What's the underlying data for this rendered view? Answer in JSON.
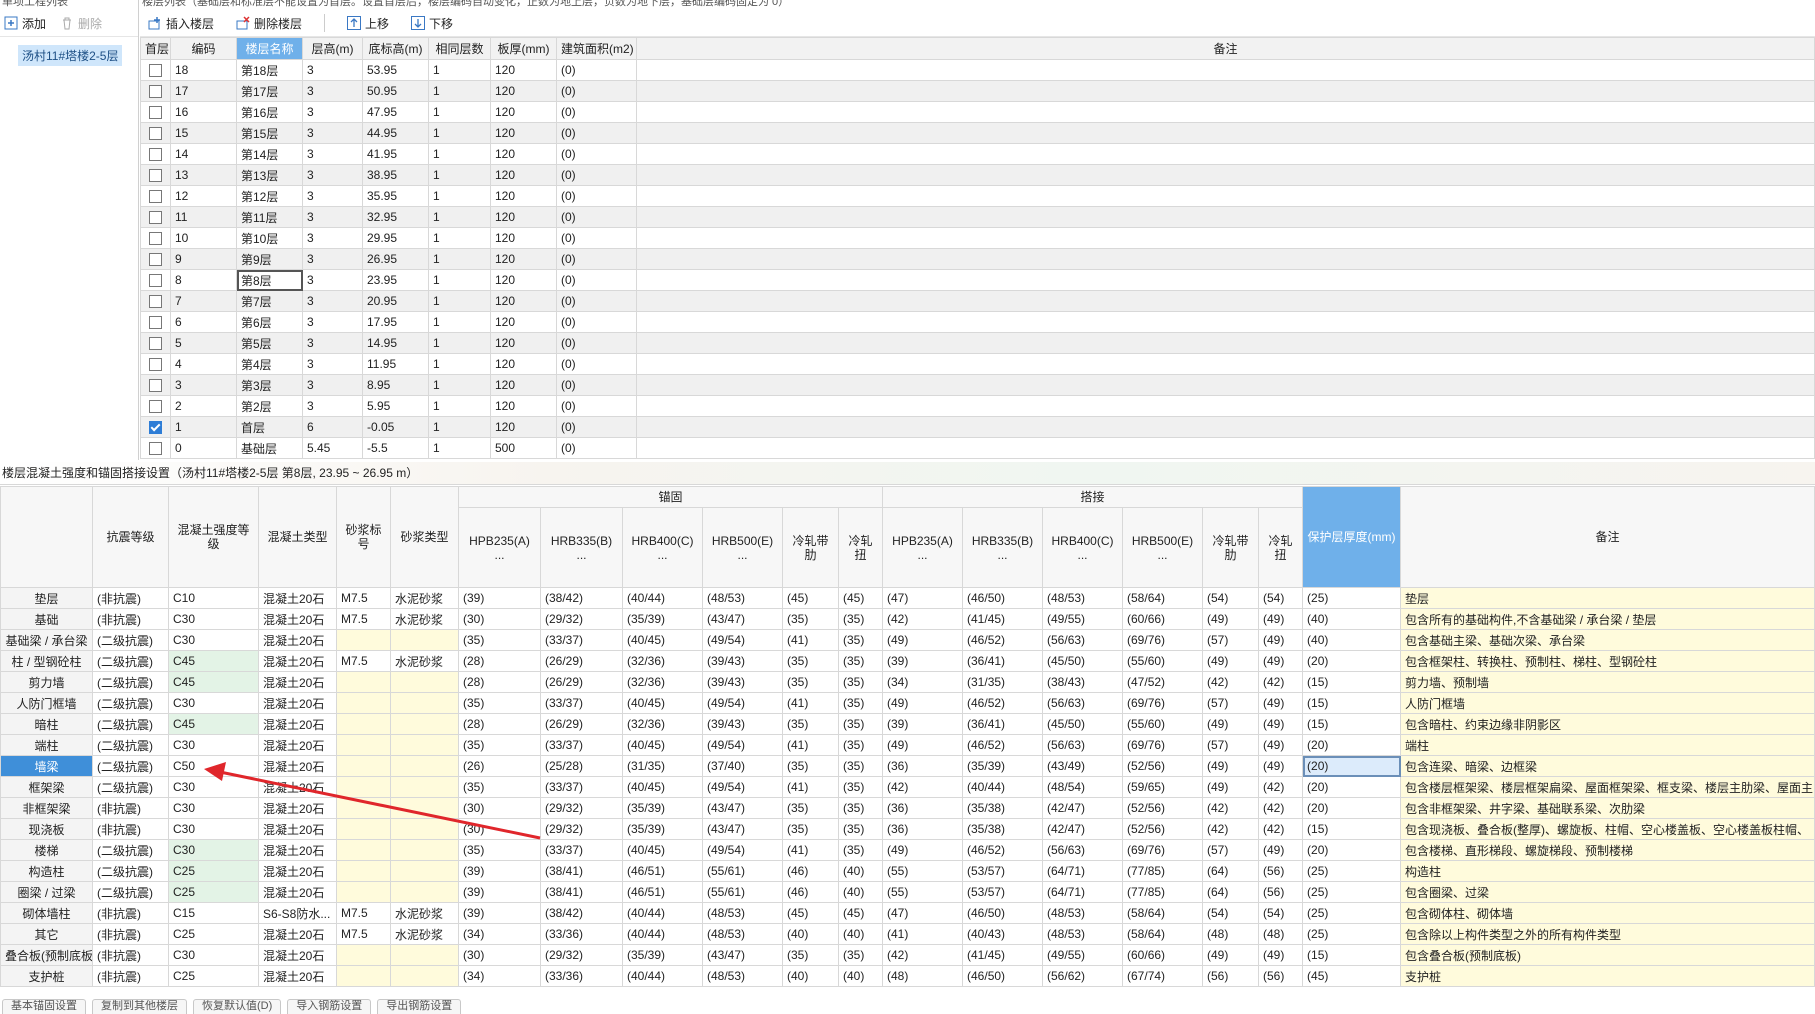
{
  "left": {
    "title": "单项工程列表",
    "add_label": "添加",
    "delete_label": "删除",
    "project_item": "汤村11#塔楼2-5层"
  },
  "floors": {
    "title": "楼层列表（基础层和标准层不能设置为首层。设置首层后，楼层编码自动变化，正数为地上层，负数为地下层，基础层编码固定为 0）",
    "toolbar": {
      "insert": "插入楼层",
      "delete": "删除楼层",
      "up": "上移",
      "down": "下移"
    },
    "columns": [
      "首层",
      "编码",
      "楼层名称",
      "层高(m)",
      "底标高(m)",
      "相同层数",
      "板厚(mm)",
      "建筑面积(m2)",
      "备注"
    ],
    "rows": [
      {
        "first": false,
        "code": "18",
        "name": "第18层",
        "height": "3",
        "bottom": "53.95",
        "same": "1",
        "thick": "120",
        "area": "(0)",
        "note": ""
      },
      {
        "first": false,
        "code": "17",
        "name": "第17层",
        "height": "3",
        "bottom": "50.95",
        "same": "1",
        "thick": "120",
        "area": "(0)",
        "note": ""
      },
      {
        "first": false,
        "code": "16",
        "name": "第16层",
        "height": "3",
        "bottom": "47.95",
        "same": "1",
        "thick": "120",
        "area": "(0)",
        "note": ""
      },
      {
        "first": false,
        "code": "15",
        "name": "第15层",
        "height": "3",
        "bottom": "44.95",
        "same": "1",
        "thick": "120",
        "area": "(0)",
        "note": ""
      },
      {
        "first": false,
        "code": "14",
        "name": "第14层",
        "height": "3",
        "bottom": "41.95",
        "same": "1",
        "thick": "120",
        "area": "(0)",
        "note": ""
      },
      {
        "first": false,
        "code": "13",
        "name": "第13层",
        "height": "3",
        "bottom": "38.95",
        "same": "1",
        "thick": "120",
        "area": "(0)",
        "note": ""
      },
      {
        "first": false,
        "code": "12",
        "name": "第12层",
        "height": "3",
        "bottom": "35.95",
        "same": "1",
        "thick": "120",
        "area": "(0)",
        "note": ""
      },
      {
        "first": false,
        "code": "11",
        "name": "第11层",
        "height": "3",
        "bottom": "32.95",
        "same": "1",
        "thick": "120",
        "area": "(0)",
        "note": ""
      },
      {
        "first": false,
        "code": "10",
        "name": "第10层",
        "height": "3",
        "bottom": "29.95",
        "same": "1",
        "thick": "120",
        "area": "(0)",
        "note": ""
      },
      {
        "first": false,
        "code": "9",
        "name": "第9层",
        "height": "3",
        "bottom": "26.95",
        "same": "1",
        "thick": "120",
        "area": "(0)",
        "note": ""
      },
      {
        "first": false,
        "code": "8",
        "name": "第8层",
        "height": "3",
        "bottom": "23.95",
        "same": "1",
        "thick": "120",
        "area": "(0)",
        "note": ""
      },
      {
        "first": false,
        "code": "7",
        "name": "第7层",
        "height": "3",
        "bottom": "20.95",
        "same": "1",
        "thick": "120",
        "area": "(0)",
        "note": ""
      },
      {
        "first": false,
        "code": "6",
        "name": "第6层",
        "height": "3",
        "bottom": "17.95",
        "same": "1",
        "thick": "120",
        "area": "(0)",
        "note": ""
      },
      {
        "first": false,
        "code": "5",
        "name": "第5层",
        "height": "3",
        "bottom": "14.95",
        "same": "1",
        "thick": "120",
        "area": "(0)",
        "note": ""
      },
      {
        "first": false,
        "code": "4",
        "name": "第4层",
        "height": "3",
        "bottom": "11.95",
        "same": "1",
        "thick": "120",
        "area": "(0)",
        "note": ""
      },
      {
        "first": false,
        "code": "3",
        "name": "第3层",
        "height": "3",
        "bottom": "8.95",
        "same": "1",
        "thick": "120",
        "area": "(0)",
        "note": ""
      },
      {
        "first": false,
        "code": "2",
        "name": "第2层",
        "height": "3",
        "bottom": "5.95",
        "same": "1",
        "thick": "120",
        "area": "(0)",
        "note": ""
      },
      {
        "first": true,
        "code": "1",
        "name": "首层",
        "height": "6",
        "bottom": "-0.05",
        "same": "1",
        "thick": "120",
        "area": "(0)",
        "note": ""
      },
      {
        "first": false,
        "code": "0",
        "name": "基础层",
        "height": "5.45",
        "bottom": "-5.5",
        "same": "1",
        "thick": "500",
        "area": "(0)",
        "note": ""
      }
    ]
  },
  "anchor": {
    "title": "楼层混凝土强度和锚固搭接设置（汤村11#塔楼2-5层  第8层, 23.95 ~ 26.95 m）",
    "group_anchor": "锚固",
    "group_lap": "搭接",
    "headers": {
      "seismic": "抗震等级",
      "grade": "混凝土强度等级",
      "ctype": "混凝土类型",
      "mortar_no": "砂浆标号",
      "mortar_type": "砂浆类型",
      "hpb235": "HPB235(A) ...",
      "hrb335": "HRB335(B) ...",
      "hrb400": "HRB400(C) ...",
      "hrb500": "HRB500(E) ...",
      "crb": "冷轧带肋",
      "crt": "冷轧扭",
      "cover": "保护层厚度(mm)",
      "note": "备注"
    },
    "rows": [
      {
        "name": "垫层",
        "seis": "(非抗震)",
        "grade": "C10",
        "ctype": "混凝土20石",
        "mno": "M7.5",
        "mtype": "水泥砂浆",
        "a": [
          "(39)",
          "(38/42)",
          "(40/44)",
          "(48/53)",
          "(45)",
          "(45)"
        ],
        "l": [
          "(47)",
          "(46/50)",
          "(48/53)",
          "(58/64)",
          "(54)",
          "(54)"
        ],
        "cover": "(25)",
        "note": "垫层"
      },
      {
        "name": "基础",
        "seis": "(非抗震)",
        "grade": "C30",
        "ctype": "混凝土20石",
        "mno": "M7.5",
        "mtype": "水泥砂浆",
        "a": [
          "(30)",
          "(29/32)",
          "(35/39)",
          "(43/47)",
          "(35)",
          "(35)"
        ],
        "l": [
          "(42)",
          "(41/45)",
          "(49/55)",
          "(60/66)",
          "(49)",
          "(49)"
        ],
        "cover": "(40)",
        "note": "包含所有的基础构件,不含基础梁 / 承台梁 / 垫层"
      },
      {
        "name": "基础梁 / 承台梁",
        "seis": "(二级抗震)",
        "grade": "C30",
        "ctype": "混凝土20石",
        "mno": "",
        "mtype": "",
        "a": [
          "(35)",
          "(33/37)",
          "(40/45)",
          "(49/54)",
          "(41)",
          "(35)"
        ],
        "l": [
          "(49)",
          "(46/52)",
          "(56/63)",
          "(69/76)",
          "(57)",
          "(49)"
        ],
        "cover": "(40)",
        "note": "包含基础主梁、基础次梁、承台梁"
      },
      {
        "name": "柱 / 型钢砼柱",
        "seis": "(二级抗震)",
        "grade": "C45",
        "ctype": "混凝土20石",
        "mno": "M7.5",
        "mtype": "水泥砂浆",
        "a": [
          "(28)",
          "(26/29)",
          "(32/36)",
          "(39/43)",
          "(35)",
          "(35)"
        ],
        "l": [
          "(39)",
          "(36/41)",
          "(45/50)",
          "(55/60)",
          "(49)",
          "(49)"
        ],
        "cover": "(20)",
        "note": "包含框架柱、转换柱、预制柱、梯柱、型钢砼柱"
      },
      {
        "name": "剪力墙",
        "seis": "(二级抗震)",
        "grade": "C45",
        "ctype": "混凝土20石",
        "mno": "",
        "mtype": "",
        "a": [
          "(28)",
          "(26/29)",
          "(32/36)",
          "(39/43)",
          "(35)",
          "(35)"
        ],
        "l": [
          "(34)",
          "(31/35)",
          "(38/43)",
          "(47/52)",
          "(42)",
          "(42)"
        ],
        "cover": "(15)",
        "note": "剪力墙、预制墙"
      },
      {
        "name": "人防门框墙",
        "seis": "(二级抗震)",
        "grade": "C30",
        "ctype": "混凝土20石",
        "mno": "",
        "mtype": "",
        "a": [
          "(35)",
          "(33/37)",
          "(40/45)",
          "(49/54)",
          "(41)",
          "(35)"
        ],
        "l": [
          "(49)",
          "(46/52)",
          "(56/63)",
          "(69/76)",
          "(57)",
          "(49)"
        ],
        "cover": "(15)",
        "note": "人防门框墙"
      },
      {
        "name": "暗柱",
        "seis": "(二级抗震)",
        "grade": "C45",
        "ctype": "混凝土20石",
        "mno": "",
        "mtype": "",
        "a": [
          "(28)",
          "(26/29)",
          "(32/36)",
          "(39/43)",
          "(35)",
          "(35)"
        ],
        "l": [
          "(39)",
          "(36/41)",
          "(45/50)",
          "(55/60)",
          "(49)",
          "(49)"
        ],
        "cover": "(15)",
        "note": "包含暗柱、约束边缘非阴影区"
      },
      {
        "name": "端柱",
        "seis": "(二级抗震)",
        "grade": "C30",
        "ctype": "混凝土20石",
        "mno": "",
        "mtype": "",
        "a": [
          "(35)",
          "(33/37)",
          "(40/45)",
          "(49/54)",
          "(41)",
          "(35)"
        ],
        "l": [
          "(49)",
          "(46/52)",
          "(56/63)",
          "(69/76)",
          "(57)",
          "(49)"
        ],
        "cover": "(20)",
        "note": "端柱"
      },
      {
        "name": "墙梁",
        "seis": "(二级抗震)",
        "grade": "C50",
        "ctype": "混凝土20石",
        "mno": "",
        "mtype": "",
        "a": [
          "(26)",
          "(25/28)",
          "(31/35)",
          "(37/40)",
          "(35)",
          "(35)"
        ],
        "l": [
          "(36)",
          "(35/39)",
          "(43/49)",
          "(52/56)",
          "(49)",
          "(49)"
        ],
        "cover": "(20)",
        "note": "包含连梁、暗梁、边框梁",
        "selected": true
      },
      {
        "name": "框架梁",
        "seis": "(二级抗震)",
        "grade": "C30",
        "ctype": "混凝土20石",
        "mno": "",
        "mtype": "",
        "a": [
          "(35)",
          "(33/37)",
          "(40/45)",
          "(49/54)",
          "(41)",
          "(35)"
        ],
        "l": [
          "(42)",
          "(40/44)",
          "(48/54)",
          "(59/65)",
          "(49)",
          "(42)"
        ],
        "cover": "(20)",
        "note": "包含楼层框架梁、楼层框架扁梁、屋面框架梁、框支梁、楼层主肋梁、屋面主"
      },
      {
        "name": "非框架梁",
        "seis": "(非抗震)",
        "grade": "C30",
        "ctype": "混凝土20石",
        "mno": "",
        "mtype": "",
        "a": [
          "(30)",
          "(29/32)",
          "(35/39)",
          "(43/47)",
          "(35)",
          "(35)"
        ],
        "l": [
          "(36)",
          "(35/38)",
          "(42/47)",
          "(52/56)",
          "(42)",
          "(42)"
        ],
        "cover": "(20)",
        "note": "包含非框架梁、井字梁、基础联系梁、次肋梁"
      },
      {
        "name": "现浇板",
        "seis": "(非抗震)",
        "grade": "C30",
        "ctype": "混凝土20石",
        "mno": "",
        "mtype": "",
        "a": [
          "(30)",
          "(29/32)",
          "(35/39)",
          "(43/47)",
          "(35)",
          "(35)"
        ],
        "l": [
          "(36)",
          "(35/38)",
          "(42/47)",
          "(52/56)",
          "(42)",
          "(42)"
        ],
        "cover": "(15)",
        "note": "包含现浇板、叠合板(整厚)、螺旋板、柱帽、空心楼盖板、空心楼盖板柱帽、"
      },
      {
        "name": "楼梯",
        "seis": "(二级抗震)",
        "grade": "C30",
        "ctype": "混凝土20石",
        "mno": "",
        "mtype": "",
        "a": [
          "(35)",
          "(33/37)",
          "(40/45)",
          "(49/54)",
          "(41)",
          "(35)"
        ],
        "l": [
          "(49)",
          "(46/52)",
          "(56/63)",
          "(69/76)",
          "(57)",
          "(49)"
        ],
        "cover": "(20)",
        "note": "包含楼梯、直形梯段、螺旋梯段、预制楼梯"
      },
      {
        "name": "构造柱",
        "seis": "(二级抗震)",
        "grade": "C25",
        "ctype": "混凝土20石",
        "mno": "",
        "mtype": "",
        "a": [
          "(39)",
          "(38/41)",
          "(46/51)",
          "(55/61)",
          "(46)",
          "(40)"
        ],
        "l": [
          "(55)",
          "(53/57)",
          "(64/71)",
          "(77/85)",
          "(64)",
          "(56)"
        ],
        "cover": "(25)",
        "note": "构造柱"
      },
      {
        "name": "圈梁 / 过梁",
        "seis": "(二级抗震)",
        "grade": "C25",
        "ctype": "混凝土20石",
        "mno": "",
        "mtype": "",
        "a": [
          "(39)",
          "(38/41)",
          "(46/51)",
          "(55/61)",
          "(46)",
          "(40)"
        ],
        "l": [
          "(55)",
          "(53/57)",
          "(64/71)",
          "(77/85)",
          "(64)",
          "(56)"
        ],
        "cover": "(25)",
        "note": "包含圈梁、过梁"
      },
      {
        "name": "砌体墙柱",
        "seis": "(非抗震)",
        "grade": "C15",
        "ctype": "S6-S8防水...",
        "mno": "M7.5",
        "mtype": "水泥砂浆",
        "a": [
          "(39)",
          "(38/42)",
          "(40/44)",
          "(48/53)",
          "(45)",
          "(45)"
        ],
        "l": [
          "(47)",
          "(46/50)",
          "(48/53)",
          "(58/64)",
          "(54)",
          "(54)"
        ],
        "cover": "(25)",
        "note": "包含砌体柱、砌体墙"
      },
      {
        "name": "其它",
        "seis": "(非抗震)",
        "grade": "C25",
        "ctype": "混凝土20石",
        "mno": "M7.5",
        "mtype": "水泥砂浆",
        "a": [
          "(34)",
          "(33/36)",
          "(40/44)",
          "(48/53)",
          "(40)",
          "(40)"
        ],
        "l": [
          "(41)",
          "(40/43)",
          "(48/53)",
          "(58/64)",
          "(48)",
          "(48)"
        ],
        "cover": "(25)",
        "note": "包含除以上构件类型之外的所有构件类型"
      },
      {
        "name": "叠合板(预制底板)",
        "seis": "(非抗震)",
        "grade": "C30",
        "ctype": "混凝土20石",
        "mno": "",
        "mtype": "",
        "a": [
          "(30)",
          "(29/32)",
          "(35/39)",
          "(43/47)",
          "(35)",
          "(35)"
        ],
        "l": [
          "(42)",
          "(41/45)",
          "(49/55)",
          "(60/66)",
          "(49)",
          "(49)"
        ],
        "cover": "(15)",
        "note": "包含叠合板(预制底板)"
      },
      {
        "name": "支护桩",
        "seis": "(非抗震)",
        "grade": "C25",
        "ctype": "混凝土20石",
        "mno": "",
        "mtype": "",
        "a": [
          "(34)",
          "(33/36)",
          "(40/44)",
          "(48/53)",
          "(40)",
          "(40)"
        ],
        "l": [
          "(48)",
          "(46/50)",
          "(56/62)",
          "(67/74)",
          "(56)",
          "(56)"
        ],
        "cover": "(45)",
        "note": "支护桩"
      }
    ]
  },
  "tabs": [
    "基本锚固设置",
    "复制到其他楼层",
    "恢复默认值(D)",
    "导入钢筋设置",
    "导出钢筋设置"
  ],
  "colors": {
    "accent": "#6fb0ea",
    "selected_row": "#3f8fd9",
    "arrow": "#e0262b"
  }
}
